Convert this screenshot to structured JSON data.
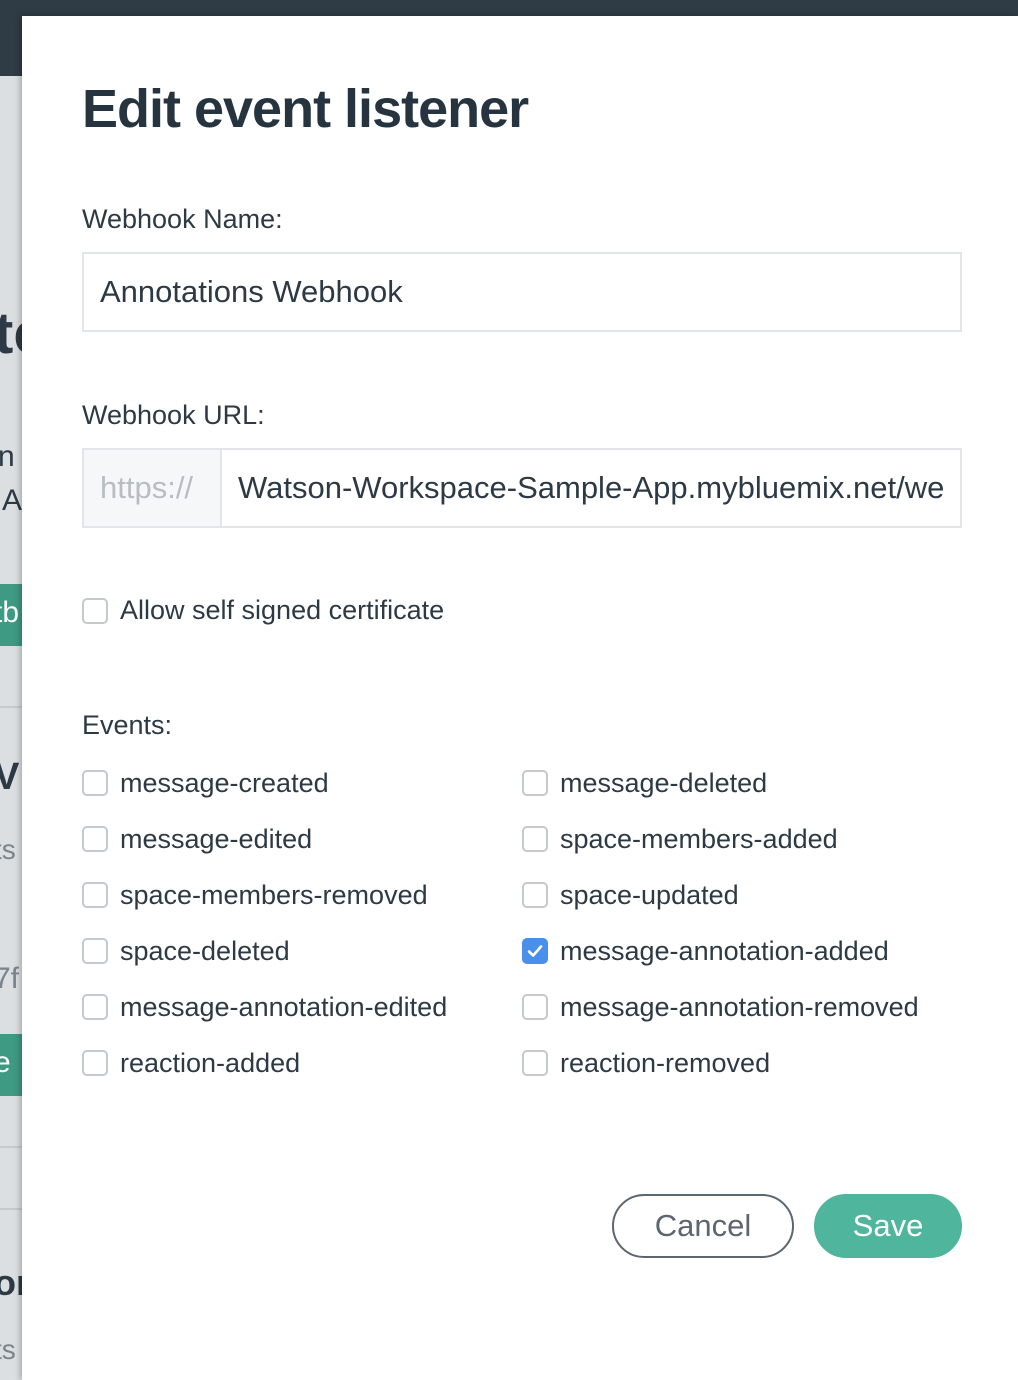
{
  "background": {
    "fragments": [
      "tc",
      "n",
      "A",
      "tb",
      "V",
      "ts",
      "7f",
      "e",
      "on",
      "ts"
    ]
  },
  "dialog": {
    "title": "Edit event listener",
    "webhook_name": {
      "label": "Webhook Name:",
      "value": "Annotations Webhook"
    },
    "webhook_url": {
      "label": "Webhook URL:",
      "prefix": "https://",
      "value": "Watson-Workspace-Sample-App.mybluemix.net/webhook"
    },
    "self_signed": {
      "label": "Allow self signed certificate",
      "checked": false
    },
    "events_label": "Events:",
    "events": [
      {
        "label": "message-created",
        "checked": false
      },
      {
        "label": "message-deleted",
        "checked": false
      },
      {
        "label": "message-edited",
        "checked": false
      },
      {
        "label": "space-members-added",
        "checked": false
      },
      {
        "label": "space-members-removed",
        "checked": false
      },
      {
        "label": "space-updated",
        "checked": false
      },
      {
        "label": "space-deleted",
        "checked": false
      },
      {
        "label": "message-annotation-added",
        "checked": true
      },
      {
        "label": "message-annotation-edited",
        "checked": false
      },
      {
        "label": "message-annotation-removed",
        "checked": false
      },
      {
        "label": "reaction-added",
        "checked": false
      },
      {
        "label": "reaction-removed",
        "checked": false
      }
    ],
    "buttons": {
      "cancel": "Cancel",
      "save": "Save"
    }
  },
  "colors": {
    "accent": "#4fb59c",
    "checkbox_checked": "#4a8fe9",
    "topbar": "#2f3b45"
  }
}
